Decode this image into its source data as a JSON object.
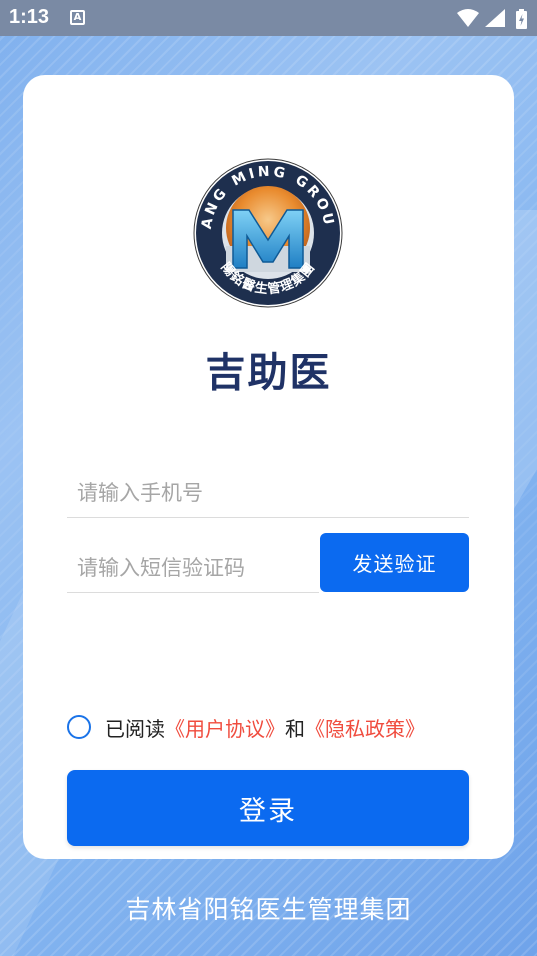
{
  "status_bar": {
    "time": "1:13",
    "notification_icon_letter": "A",
    "icons": [
      "wifi-icon",
      "cell-signal-icon",
      "battery-icon"
    ]
  },
  "logo": {
    "ring_text": "YANG MING GROUP",
    "seal_text": "陽銘醫生管理集團",
    "monogram": "M"
  },
  "app": {
    "title": "吉助医"
  },
  "form": {
    "phone_placeholder": "请输入手机号",
    "phone_value": "",
    "sms_placeholder": "请输入短信验证码",
    "sms_value": "",
    "send_code_label": "发送验证"
  },
  "agreement": {
    "checked": false,
    "prefix": "已阅读",
    "user_agreement": "《用户协议》",
    "conjunction": "和",
    "privacy_policy": "《隐私政策》"
  },
  "login": {
    "label": "登录"
  },
  "footer": {
    "org_name": "吉林省阳铭医生管理集团"
  },
  "colors": {
    "primary": "#0b6af0",
    "title": "#1f3266",
    "link": "#f04c3e",
    "radio": "#1a73e8",
    "background": "#84b5f0"
  }
}
